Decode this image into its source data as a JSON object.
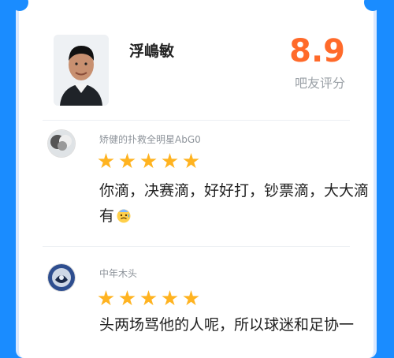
{
  "header": {
    "player_name": "浮嶋敏",
    "score": "8.9",
    "score_label": "吧友评分"
  },
  "reviews": [
    {
      "username": "矫健的扑救全明星AbG0",
      "stars": 5,
      "text_line1": "你滴，决赛滴，好好打，钞票滴，大大滴",
      "text_line2": "有"
    },
    {
      "username": "中年木头",
      "stars": 5,
      "text_line1": "头两场骂他的人呢，所以球迷和足协一"
    }
  ],
  "icons": {
    "player_photo": "player-portrait",
    "emoji": "sweating-face-emoji"
  },
  "colors": {
    "background": "#1a8cff",
    "score": "#ff6a2a",
    "star": "#ffb320"
  }
}
